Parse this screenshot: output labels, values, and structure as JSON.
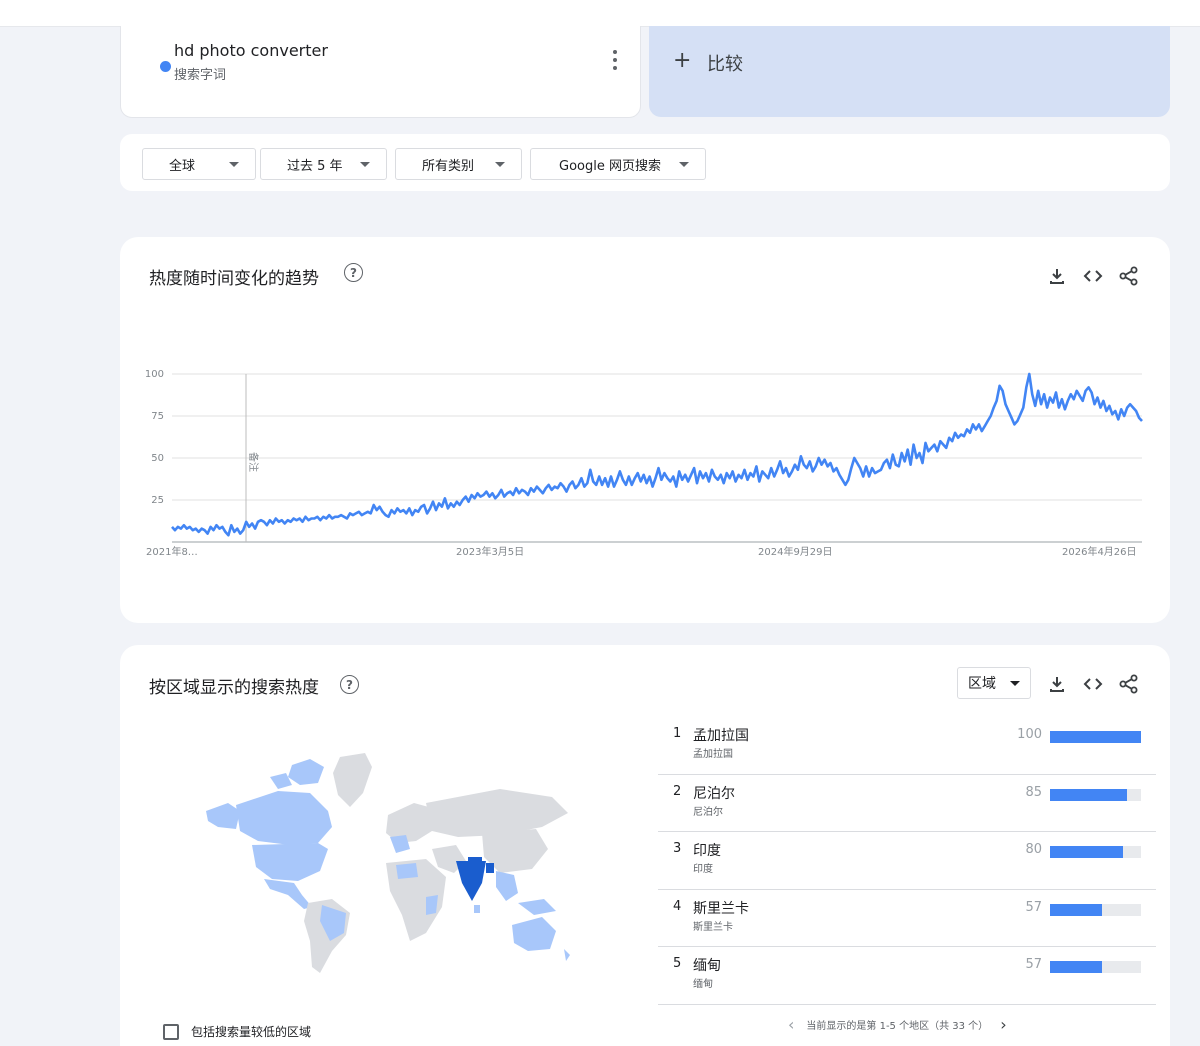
{
  "search_term": {
    "name": "hd photo converter",
    "type_label": "搜索字词",
    "color": "#4285f4"
  },
  "compare": {
    "plus": "+",
    "label": "比较"
  },
  "filters": [
    {
      "label": "全球"
    },
    {
      "label": "过去 5 年"
    },
    {
      "label": "所有类别"
    },
    {
      "label": "Google 网页搜索"
    }
  ],
  "trend_card": {
    "title": "热度随时间变化的趋势",
    "note_label": "备注",
    "actions": [
      "download-icon",
      "embed-icon",
      "share-icon"
    ]
  },
  "chart_data": {
    "type": "line",
    "title": "",
    "xlabel": "",
    "ylabel": "",
    "ylim": [
      0,
      100
    ],
    "y_ticks": [
      "100",
      "75",
      "50",
      "25"
    ],
    "x_ticks": [
      "2021年8…",
      "2023年3月5日",
      "2024年9月29日",
      "2026年4月26日"
    ],
    "grid": true,
    "series": [
      {
        "color": "#4285f4",
        "values": [
          9,
          7,
          9,
          8,
          10,
          8,
          9,
          7,
          8,
          6,
          8,
          7,
          5,
          9,
          7,
          10,
          8,
          9,
          6,
          4,
          10,
          6,
          8,
          5,
          7,
          12,
          9,
          11,
          8,
          12,
          13,
          12,
          10,
          13,
          11,
          14,
          12,
          13,
          11,
          13,
          12,
          14,
          13,
          14,
          12,
          15,
          13,
          14,
          14,
          15,
          13,
          15,
          14,
          16,
          14,
          15,
          15,
          16,
          15,
          14,
          17,
          16,
          17,
          18,
          16,
          17,
          18,
          17,
          22,
          19,
          21,
          18,
          16,
          15,
          19,
          17,
          20,
          18,
          19,
          17,
          20,
          16,
          19,
          18,
          21,
          22,
          17,
          20,
          24,
          19,
          23,
          21,
          26,
          20,
          23,
          21,
          24,
          22,
          25,
          27,
          24,
          28,
          26,
          29,
          27,
          28,
          30,
          27,
          29,
          26,
          28,
          31,
          27,
          29,
          30,
          28,
          32,
          29,
          31,
          30,
          28,
          32,
          30,
          33,
          31,
          29,
          32,
          34,
          31,
          33,
          32,
          35,
          33,
          30,
          34,
          36,
          32,
          34,
          38,
          33,
          35,
          43,
          36,
          34,
          39,
          34,
          38,
          33,
          39,
          33,
          37,
          42,
          37,
          34,
          39,
          34,
          38,
          41,
          36,
          40,
          35,
          39,
          33,
          38,
          44,
          37,
          41,
          38,
          36,
          39,
          33,
          42,
          37,
          40,
          36,
          40,
          44,
          35,
          42,
          38,
          41,
          36,
          43,
          39,
          37,
          40,
          35,
          41,
          38,
          42,
          36,
          40,
          38,
          43,
          37,
          41,
          39,
          45,
          36,
          42,
          40,
          38,
          44,
          39,
          43,
          48,
          41,
          44,
          39,
          42,
          46,
          43,
          51,
          46,
          44,
          48,
          42,
          45,
          50,
          46,
          49,
          45,
          47,
          42,
          44,
          40,
          37,
          34,
          37,
          44,
          50,
          47,
          44,
          39,
          45,
          39,
          44,
          41,
          42,
          43,
          47,
          49,
          44,
          52,
          46,
          45,
          53,
          48,
          55,
          46,
          58,
          50,
          53,
          47,
          59,
          54,
          56,
          58,
          54,
          60,
          58,
          56,
          62,
          60,
          65,
          62,
          64,
          63,
          67,
          65,
          70,
          67,
          70,
          66,
          69,
          72,
          75,
          80,
          84,
          93,
          90,
          82,
          78,
          74,
          70,
          72,
          76,
          80,
          92,
          100,
          88,
          81,
          90,
          82,
          88,
          80,
          86,
          83,
          89,
          80,
          85,
          79,
          84,
          88,
          85,
          90,
          87,
          84,
          90,
          92,
          89,
          82,
          86,
          80,
          84,
          78,
          81,
          76,
          78,
          73,
          79,
          75,
          80,
          82,
          80,
          78,
          74,
          72
        ]
      }
    ]
  },
  "region_card": {
    "title": "按区域显示的搜索热度",
    "resolution_select": "区域",
    "actions": [
      "download-icon",
      "embed-icon",
      "share-icon"
    ],
    "rankings": [
      {
        "rank": "1",
        "name": "孟加拉国",
        "subname": "孟加拉国",
        "value": 100
      },
      {
        "rank": "2",
        "name": "尼泊尔",
        "subname": "尼泊尔",
        "value": 85
      },
      {
        "rank": "3",
        "name": "印度",
        "subname": "印度",
        "value": 80
      },
      {
        "rank": "4",
        "name": "斯里兰卡",
        "subname": "斯里兰卡",
        "value": 57
      },
      {
        "rank": "5",
        "name": "缅甸",
        "subname": "缅甸",
        "value": 57
      }
    ],
    "pager_text": "当前显示的是第 1-5 个地区（共 33 个）",
    "low_volume_label": "包括搜索量较低的区域",
    "map_colors": {
      "high": "#1a5dce",
      "medium": "#a8c7fa",
      "none": "#dadce0"
    }
  }
}
